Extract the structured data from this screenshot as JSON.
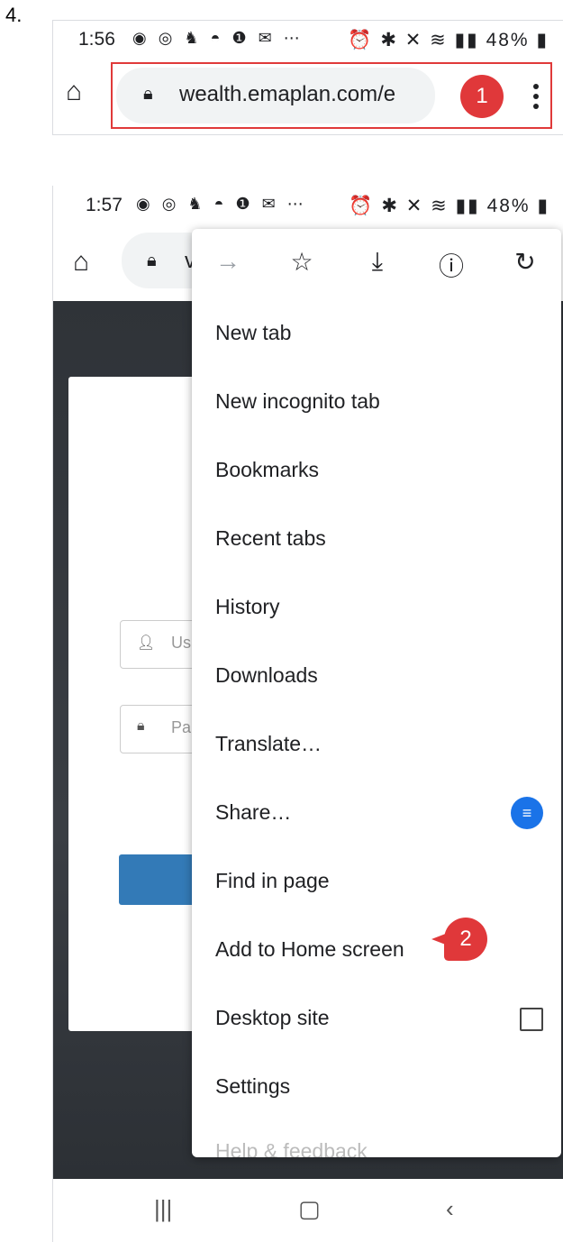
{
  "step_label": "4.",
  "screen1": {
    "status": {
      "time": "1:56",
      "right": "48%"
    },
    "url": "wealth.emaplan.com/e",
    "callout": "1"
  },
  "screen2": {
    "status": {
      "time": "1:57",
      "right": "48%"
    },
    "url_partial": "v",
    "login": {
      "username_placeholder": "Us",
      "password_placeholder": "Pa"
    },
    "menu": {
      "top_icons": [
        "forward-icon",
        "star-icon",
        "download-icon",
        "info-icon",
        "refresh-icon"
      ],
      "items": [
        "New tab",
        "New incognito tab",
        "Bookmarks",
        "Recent tabs",
        "History",
        "Downloads",
        "Translate…",
        "Share…",
        "Find in page",
        "Add to Home screen",
        "Desktop site",
        "Settings",
        "Help & feedback"
      ]
    },
    "callout": "2"
  },
  "colors": {
    "callout": "#e0383a",
    "highlight": "#e03a3a",
    "login_button": "#337ab7"
  }
}
